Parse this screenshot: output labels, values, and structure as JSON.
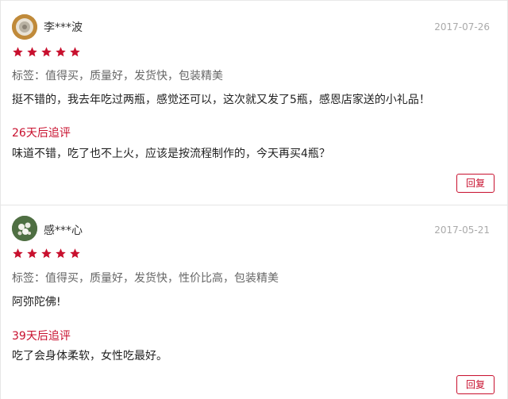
{
  "colors": {
    "accent": "#c8102e",
    "star": "#c8102e",
    "date": "#aaaaaa",
    "tags": "#666666"
  },
  "reviews": [
    {
      "username": "李***波",
      "date": "2017-07-26",
      "rating": 5,
      "tags": "标签：值得买，质量好，发货快，包装精美",
      "content": "挺不错的，我去年吃过两瓶，感觉还可以，这次就又发了5瓶，感恩店家送的小礼品！",
      "followup_title": "26天后追评",
      "followup_text": "味道不错，吃了也不上火，应该是按流程制作的，今天再买4瓶？",
      "reply_label": "回复",
      "avatar_icon": "user-avatar-icon"
    },
    {
      "username": "感***心",
      "date": "2017-05-21",
      "rating": 5,
      "tags": "标签：值得买，质量好，发货快，性价比高，包装精美",
      "content": "阿弥陀佛!",
      "followup_title": "39天后追评",
      "followup_text": "吃了会身体柔软，女性吃最好。",
      "reply_label": "回复",
      "avatar_icon": "user-avatar-icon"
    }
  ]
}
